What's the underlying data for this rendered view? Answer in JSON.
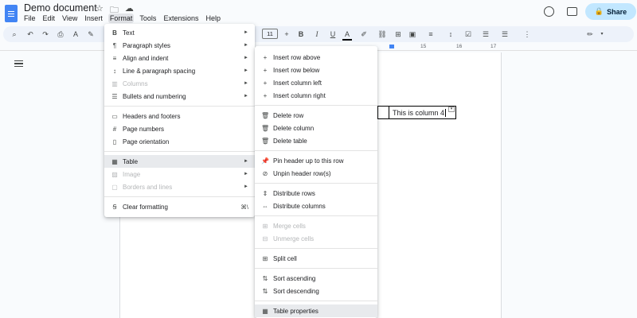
{
  "header": {
    "doc_title": "Demo document",
    "share_label": "Share"
  },
  "menubar": [
    "File",
    "Edit",
    "View",
    "Insert",
    "Format",
    "Tools",
    "Extensions",
    "Help"
  ],
  "toolbar": {
    "font_size": "11"
  },
  "ruler": [
    "15",
    "16",
    "17"
  ],
  "document": {
    "table_cell_text": "This is column 4"
  },
  "format_menu": {
    "items": [
      {
        "icon": "B",
        "label": "Text",
        "submenu": true
      },
      {
        "icon": "¶",
        "label": "Paragraph styles",
        "submenu": true
      },
      {
        "icon": "≡",
        "label": "Align and indent",
        "submenu": true
      },
      {
        "icon": "↕",
        "label": "Line & paragraph spacing",
        "submenu": true
      },
      {
        "icon": "▥",
        "label": "Columns",
        "submenu": true,
        "disabled": true
      },
      {
        "icon": "☰",
        "label": "Bullets and numbering",
        "submenu": true
      },
      {
        "icon": "▭",
        "label": "Headers and footers"
      },
      {
        "icon": "#",
        "label": "Page numbers"
      },
      {
        "icon": "▯",
        "label": "Page orientation"
      },
      {
        "icon": "▦",
        "label": "Table",
        "submenu": true,
        "highlighted": true
      },
      {
        "icon": "▨",
        "label": "Image",
        "submenu": true,
        "disabled": true
      },
      {
        "icon": "▢",
        "label": "Borders and lines",
        "submenu": true,
        "disabled": true
      },
      {
        "icon": "Ꞩ",
        "label": "Clear formatting",
        "shortcut": "⌘\\"
      }
    ]
  },
  "table_submenu": {
    "items": [
      {
        "icon": "+",
        "label": "Insert row above"
      },
      {
        "icon": "+",
        "label": "Insert row below"
      },
      {
        "icon": "+",
        "label": "Insert column left"
      },
      {
        "icon": "+",
        "label": "Insert column right"
      },
      {
        "icon": "🗑",
        "label": "Delete row"
      },
      {
        "icon": "🗑",
        "label": "Delete column"
      },
      {
        "icon": "🗑",
        "label": "Delete table"
      },
      {
        "icon": "📌",
        "label": "Pin header up to this row"
      },
      {
        "icon": "⊘",
        "label": "Unpin header row(s)"
      },
      {
        "icon": "⇕",
        "label": "Distribute rows"
      },
      {
        "icon": "⇔",
        "label": "Distribute columns"
      },
      {
        "icon": "⊞",
        "label": "Merge cells",
        "disabled": true
      },
      {
        "icon": "⊟",
        "label": "Unmerge cells",
        "disabled": true
      },
      {
        "icon": "⊞",
        "label": "Split cell"
      },
      {
        "icon": "⇅",
        "label": "Sort ascending"
      },
      {
        "icon": "⇅",
        "label": "Sort descending"
      },
      {
        "icon": "▦",
        "label": "Table properties",
        "highlighted": true
      }
    ]
  }
}
